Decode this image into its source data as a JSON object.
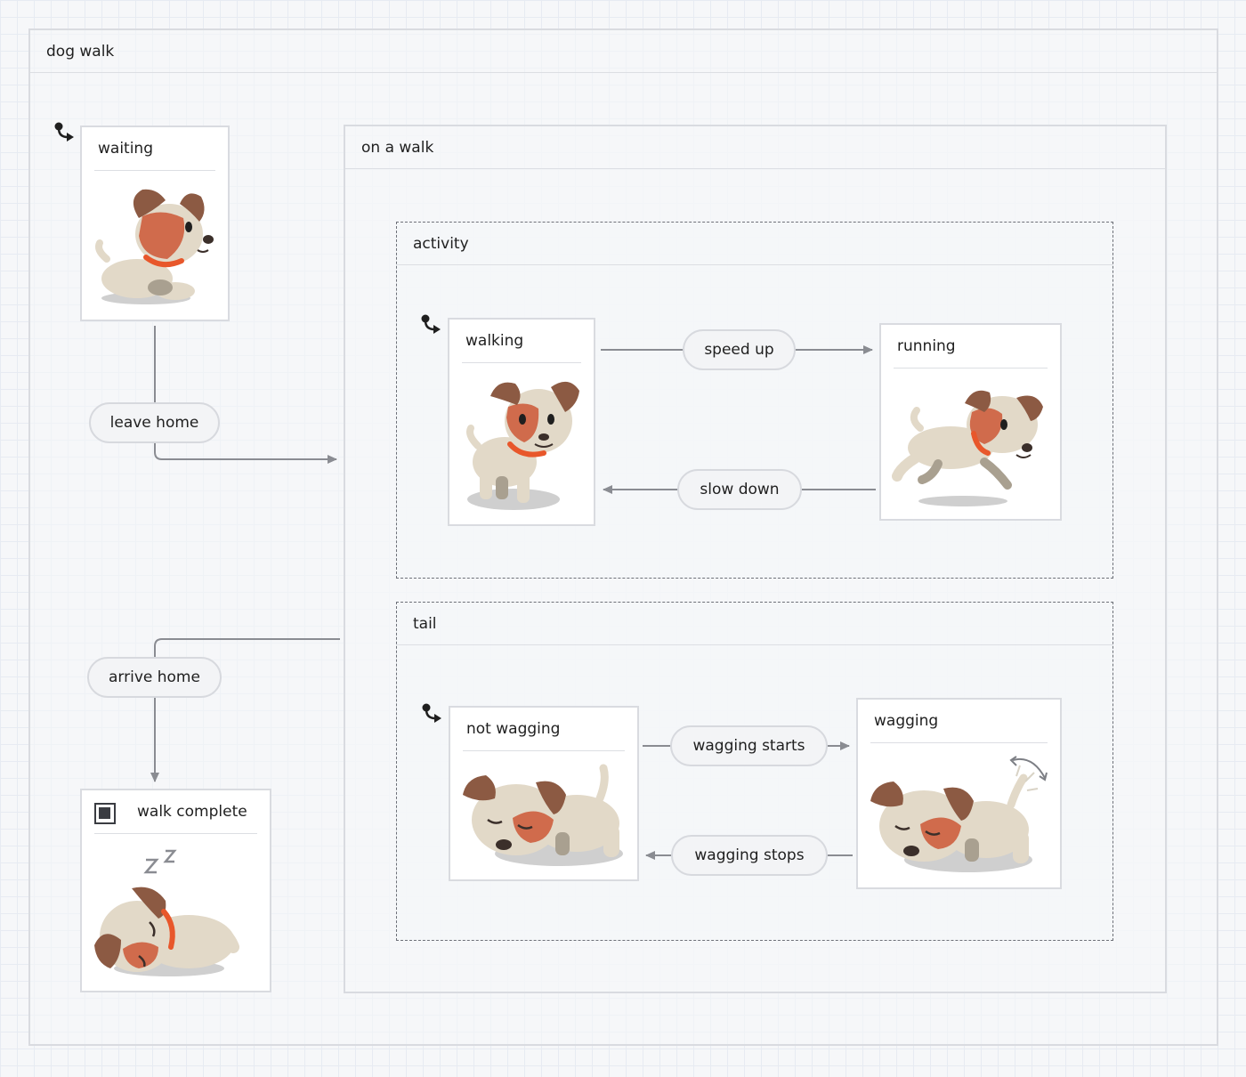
{
  "machine": {
    "title": "dog walk",
    "states": {
      "waiting": {
        "label": "waiting"
      },
      "on_a_walk": {
        "label": "on a walk"
      },
      "walk_complete": {
        "label": "walk complete"
      }
    },
    "regions": {
      "activity": {
        "label": "activity",
        "states": {
          "walking": "walking",
          "running": "running"
        }
      },
      "tail": {
        "label": "tail",
        "states": {
          "not_wagging": "not wagging",
          "wagging": "wagging"
        }
      }
    },
    "transitions": {
      "leave_home": "leave home",
      "arrive_home": "arrive home",
      "speed_up": "speed up",
      "slow_down": "slow down",
      "wagging_starts": "wagging starts",
      "wagging_stops": "wagging stops"
    }
  },
  "colors": {
    "dog_body": "#e2d9c8",
    "dog_ear": "#8c5a43",
    "dog_patch": "#d06b4c",
    "dog_collar": "#e8572b",
    "shadow": "#cfcfcf",
    "edge": "#8a8c92",
    "ink": "#1f1f1f"
  },
  "icons": [
    "initial-state-icon",
    "final-state-icon",
    "zzz-icon",
    "wag-arrow-icon"
  ]
}
